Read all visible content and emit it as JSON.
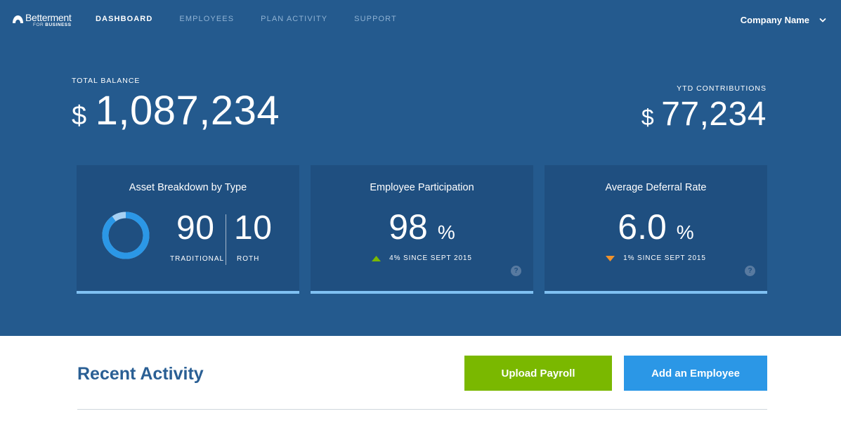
{
  "brand": {
    "name": "Betterment",
    "sub_for": "FOR",
    "sub_business": "BUSINESS"
  },
  "nav": [
    {
      "label": "DASHBOARD",
      "active": true
    },
    {
      "label": "EMPLOYEES",
      "active": false
    },
    {
      "label": "PLAN ACTIVITY",
      "active": false
    },
    {
      "label": "SUPPORT",
      "active": false
    }
  ],
  "account": {
    "company": "Company Name"
  },
  "totals": {
    "balance_label": "TOTAL BALANCE",
    "currency": "$",
    "balance": "1,087,234",
    "ytd_label": "YTD CONTRIBUTIONS",
    "ytd": "77,234"
  },
  "cards": {
    "assets": {
      "title": "Asset Breakdown by Type",
      "traditional_value": "90",
      "traditional_label": "TRADITIONAL",
      "roth_value": "10",
      "roth_label": "ROTH",
      "traditional_fraction": 0.9
    },
    "participation": {
      "title": "Employee Participation",
      "value": "98",
      "unit": "%",
      "change": "4% SINCE SEPT 2015",
      "trend": "up"
    },
    "deferral": {
      "title": "Average Deferral Rate",
      "value": "6.0",
      "unit": "%",
      "change": "1% SINCE SEPT 2015",
      "trend": "down"
    },
    "help_glyph": "?"
  },
  "activity": {
    "title": "Recent Activity",
    "upload_label": "Upload Payroll",
    "add_label": "Add an Employee"
  },
  "colors": {
    "hero_bg": "#245a8e",
    "card_bg": "#1f4f80",
    "accent_blue": "#2b97e6",
    "accent_green": "#7ab800",
    "trend_up": "#7ab800",
    "trend_down": "#f0922b",
    "roth_segment": "#a7d0f2"
  },
  "icons": {
    "logo": "betterment-logo-icon",
    "account_menu": "chevron-down-icon",
    "help": "help-icon",
    "trend_up": "triangle-up-icon",
    "trend_down": "triangle-down-icon"
  }
}
